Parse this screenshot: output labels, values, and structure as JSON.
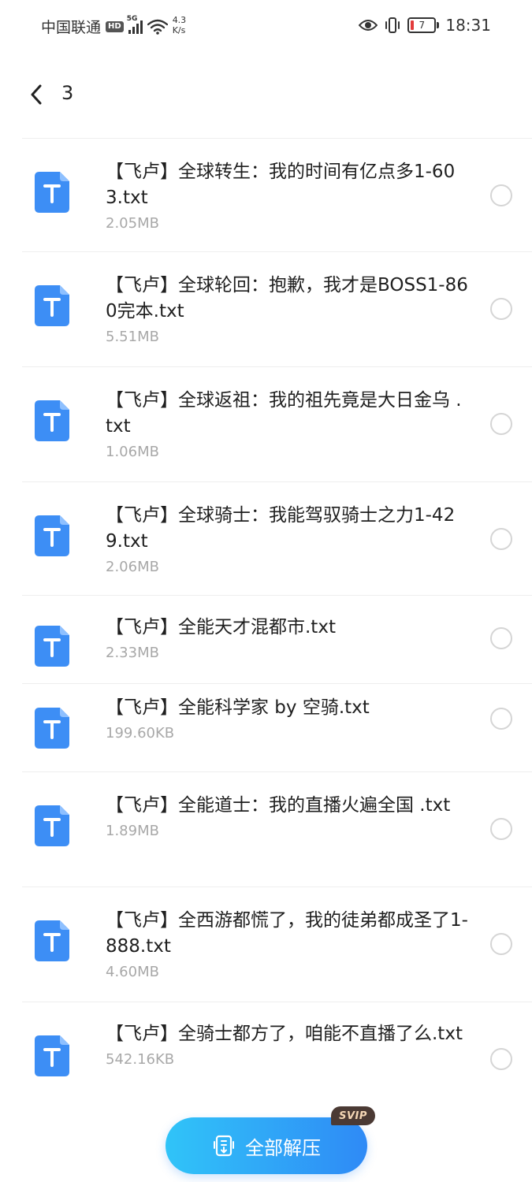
{
  "status_bar": {
    "carrier": "中国联通",
    "hd_badge": "HD",
    "network_type": "5G",
    "speed_value": "4.3",
    "speed_unit": "K/s",
    "battery_level": "7",
    "time": "18:31"
  },
  "header": {
    "title": "3"
  },
  "files": [
    {
      "name": "【飞卢】全球转生：我的时间有亿点多1-603.txt",
      "size": "2.05MB"
    },
    {
      "name": "【飞卢】全球轮回：抱歉，我才是BOSS1-860完本.txt",
      "size": "5.51MB"
    },
    {
      "name": "【飞卢】全球返祖：我的祖先竟是大日金乌 .txt",
      "size": "1.06MB"
    },
    {
      "name": "【飞卢】全球骑士：我能驾驭骑士之力1-429.txt",
      "size": "2.06MB"
    },
    {
      "name": "【飞卢】全能天才混都市.txt",
      "size": "2.33MB"
    },
    {
      "name": "【飞卢】全能科学家 by 空骑.txt",
      "size": "199.60KB"
    },
    {
      "name": "【飞卢】全能道士：我的直播火遍全国 .txt",
      "size": "1.89MB"
    },
    {
      "name": "【飞卢】全西游都慌了，我的徒弟都成圣了1-888.txt",
      "size": "4.60MB"
    },
    {
      "name": "【飞卢】全骑士都方了，咱能不直播了么.txt",
      "size": "542.16KB"
    }
  ],
  "file_icon_letter": "T",
  "extract_button": {
    "label": "全部解压",
    "badge": "SVIP"
  },
  "colors": {
    "file_icon": "#3d8ef5",
    "button_start": "#30c4f8",
    "button_end": "#2f8af6"
  }
}
